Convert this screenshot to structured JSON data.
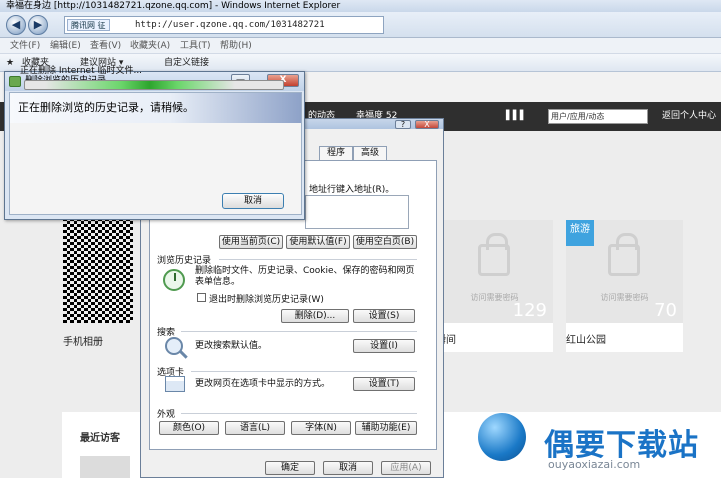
{
  "browser": {
    "title": "幸福在身边 [http://1031482721.qzone.qq.com] - Windows Internet Explorer",
    "site_tag": "腾讯网 征",
    "url": "http://user.qzone.qq.com/1031482721",
    "back_glyph": "◀",
    "forward_glyph": "▶",
    "menu": [
      "文件(F)",
      "编辑(E)",
      "查看(V)",
      "收藏夹(A)",
      "工具(T)",
      "帮助(H)"
    ],
    "favorites_label": "收藏夹",
    "fav_links": [
      "建议网站 ▾",
      "自定义链接"
    ]
  },
  "page": {
    "topbar_snippet": "的动态",
    "happiness": "幸福度 52",
    "search_placeholder": "用户/应用/动态",
    "back_home": "返回个人中心",
    "qr_album": "手机相册",
    "cards": [
      {
        "pw": "访问需要密码",
        "count": "129",
        "name": "瞬间"
      },
      {
        "pw": "访问需要密码",
        "count": "70",
        "name": "红山公园"
      }
    ],
    "travel_tag": "旅游",
    "recent_visitors": "最近访客"
  },
  "watermark": {
    "text": "偶要下载站",
    "url": "ouyaoxiazai.com"
  },
  "options_dialog": {
    "help_glyph": "?",
    "close_glyph": "X",
    "tabs": [
      "程序",
      "高级"
    ],
    "homepage_text": "地址行键入地址(R)。",
    "btn_use_current": "使用当前页(C)",
    "btn_use_default": "使用默认值(F)",
    "btn_use_blank": "使用空白页(B)",
    "history_label": "浏览历史记录",
    "history_desc": "删除临时文件、历史记录、Cookie、保存的密码和网页表单信息。",
    "delete_on_exit": "退出时删除浏览历史记录(W)",
    "btn_delete": "删除(D)...",
    "btn_settings": "设置(S)",
    "search_label": "搜索",
    "search_desc": "更改搜索默认值。",
    "btn_search_settings": "设置(I)",
    "tabs_label": "选项卡",
    "tabs_desc": "更改网页在选项卡中显示的方式。",
    "btn_tabs_settings": "设置(T)",
    "appearance_label": "外观",
    "btn_colors": "颜色(O)",
    "btn_languages": "语言(L)",
    "btn_fonts": "字体(N)",
    "btn_accessibility": "辅助功能(E)",
    "btn_ok": "确定",
    "btn_cancel": "取消",
    "btn_apply": "应用(A)"
  },
  "delete_dialog": {
    "title": "删除浏览的历史记录",
    "heading": "正在删除浏览的历史记录，请稍候。",
    "status": "正在删除 Internet 临时文件...",
    "cancel": "取消",
    "minimize_glyph": "—",
    "close_glyph": "X"
  }
}
